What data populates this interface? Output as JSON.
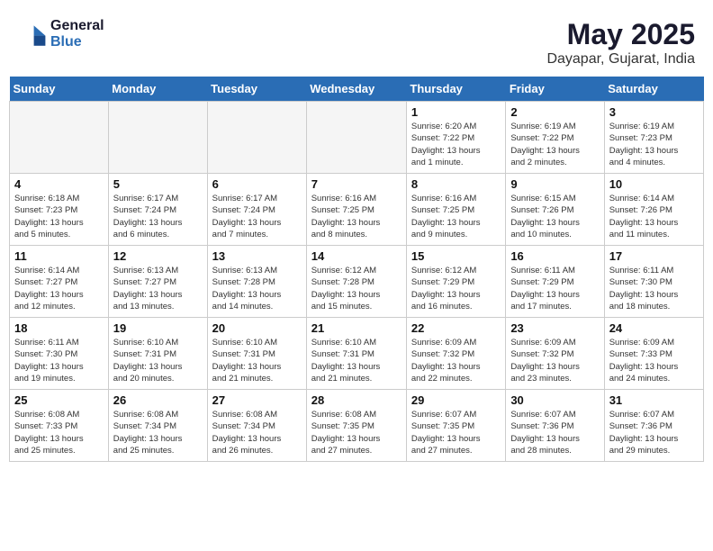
{
  "header": {
    "logo_general": "General",
    "logo_blue": "Blue",
    "month": "May 2025",
    "location": "Dayapar, Gujarat, India"
  },
  "weekdays": [
    "Sunday",
    "Monday",
    "Tuesday",
    "Wednesday",
    "Thursday",
    "Friday",
    "Saturday"
  ],
  "weeks": [
    [
      {
        "day": "",
        "info": ""
      },
      {
        "day": "",
        "info": ""
      },
      {
        "day": "",
        "info": ""
      },
      {
        "day": "",
        "info": ""
      },
      {
        "day": "1",
        "info": "Sunrise: 6:20 AM\nSunset: 7:22 PM\nDaylight: 13 hours\nand 1 minute."
      },
      {
        "day": "2",
        "info": "Sunrise: 6:19 AM\nSunset: 7:22 PM\nDaylight: 13 hours\nand 2 minutes."
      },
      {
        "day": "3",
        "info": "Sunrise: 6:19 AM\nSunset: 7:23 PM\nDaylight: 13 hours\nand 4 minutes."
      }
    ],
    [
      {
        "day": "4",
        "info": "Sunrise: 6:18 AM\nSunset: 7:23 PM\nDaylight: 13 hours\nand 5 minutes."
      },
      {
        "day": "5",
        "info": "Sunrise: 6:17 AM\nSunset: 7:24 PM\nDaylight: 13 hours\nand 6 minutes."
      },
      {
        "day": "6",
        "info": "Sunrise: 6:17 AM\nSunset: 7:24 PM\nDaylight: 13 hours\nand 7 minutes."
      },
      {
        "day": "7",
        "info": "Sunrise: 6:16 AM\nSunset: 7:25 PM\nDaylight: 13 hours\nand 8 minutes."
      },
      {
        "day": "8",
        "info": "Sunrise: 6:16 AM\nSunset: 7:25 PM\nDaylight: 13 hours\nand 9 minutes."
      },
      {
        "day": "9",
        "info": "Sunrise: 6:15 AM\nSunset: 7:26 PM\nDaylight: 13 hours\nand 10 minutes."
      },
      {
        "day": "10",
        "info": "Sunrise: 6:14 AM\nSunset: 7:26 PM\nDaylight: 13 hours\nand 11 minutes."
      }
    ],
    [
      {
        "day": "11",
        "info": "Sunrise: 6:14 AM\nSunset: 7:27 PM\nDaylight: 13 hours\nand 12 minutes."
      },
      {
        "day": "12",
        "info": "Sunrise: 6:13 AM\nSunset: 7:27 PM\nDaylight: 13 hours\nand 13 minutes."
      },
      {
        "day": "13",
        "info": "Sunrise: 6:13 AM\nSunset: 7:28 PM\nDaylight: 13 hours\nand 14 minutes."
      },
      {
        "day": "14",
        "info": "Sunrise: 6:12 AM\nSunset: 7:28 PM\nDaylight: 13 hours\nand 15 minutes."
      },
      {
        "day": "15",
        "info": "Sunrise: 6:12 AM\nSunset: 7:29 PM\nDaylight: 13 hours\nand 16 minutes."
      },
      {
        "day": "16",
        "info": "Sunrise: 6:11 AM\nSunset: 7:29 PM\nDaylight: 13 hours\nand 17 minutes."
      },
      {
        "day": "17",
        "info": "Sunrise: 6:11 AM\nSunset: 7:30 PM\nDaylight: 13 hours\nand 18 minutes."
      }
    ],
    [
      {
        "day": "18",
        "info": "Sunrise: 6:11 AM\nSunset: 7:30 PM\nDaylight: 13 hours\nand 19 minutes."
      },
      {
        "day": "19",
        "info": "Sunrise: 6:10 AM\nSunset: 7:31 PM\nDaylight: 13 hours\nand 20 minutes."
      },
      {
        "day": "20",
        "info": "Sunrise: 6:10 AM\nSunset: 7:31 PM\nDaylight: 13 hours\nand 21 minutes."
      },
      {
        "day": "21",
        "info": "Sunrise: 6:10 AM\nSunset: 7:31 PM\nDaylight: 13 hours\nand 21 minutes."
      },
      {
        "day": "22",
        "info": "Sunrise: 6:09 AM\nSunset: 7:32 PM\nDaylight: 13 hours\nand 22 minutes."
      },
      {
        "day": "23",
        "info": "Sunrise: 6:09 AM\nSunset: 7:32 PM\nDaylight: 13 hours\nand 23 minutes."
      },
      {
        "day": "24",
        "info": "Sunrise: 6:09 AM\nSunset: 7:33 PM\nDaylight: 13 hours\nand 24 minutes."
      }
    ],
    [
      {
        "day": "25",
        "info": "Sunrise: 6:08 AM\nSunset: 7:33 PM\nDaylight: 13 hours\nand 25 minutes."
      },
      {
        "day": "26",
        "info": "Sunrise: 6:08 AM\nSunset: 7:34 PM\nDaylight: 13 hours\nand 25 minutes."
      },
      {
        "day": "27",
        "info": "Sunrise: 6:08 AM\nSunset: 7:34 PM\nDaylight: 13 hours\nand 26 minutes."
      },
      {
        "day": "28",
        "info": "Sunrise: 6:08 AM\nSunset: 7:35 PM\nDaylight: 13 hours\nand 27 minutes."
      },
      {
        "day": "29",
        "info": "Sunrise: 6:07 AM\nSunset: 7:35 PM\nDaylight: 13 hours\nand 27 minutes."
      },
      {
        "day": "30",
        "info": "Sunrise: 6:07 AM\nSunset: 7:36 PM\nDaylight: 13 hours\nand 28 minutes."
      },
      {
        "day": "31",
        "info": "Sunrise: 6:07 AM\nSunset: 7:36 PM\nDaylight: 13 hours\nand 29 minutes."
      }
    ]
  ]
}
